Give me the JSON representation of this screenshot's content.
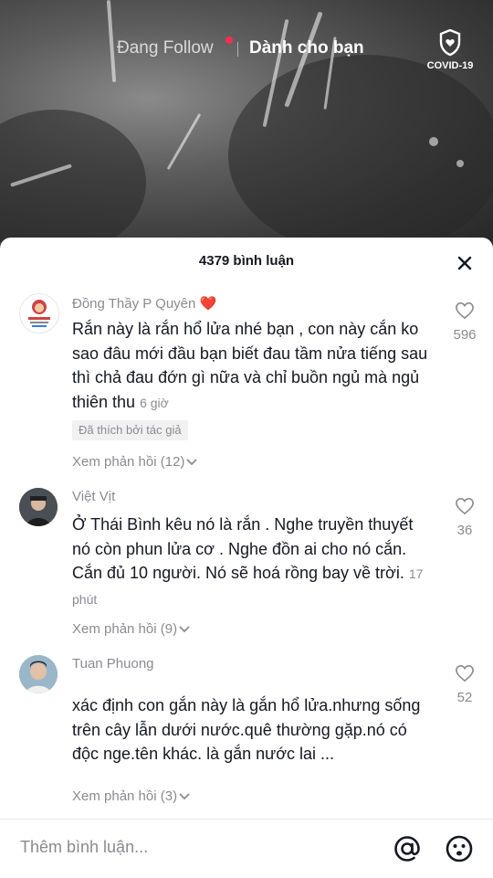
{
  "topnav": {
    "following": "Đang Follow",
    "for_you": "Dành cho bạn",
    "covid_label": "COVID-19"
  },
  "sheet": {
    "title": "4379 bình luận"
  },
  "comments": [
    {
      "user": "Đồng Thầy P Quyên ❤️",
      "text": "Rắn này là rắn hổ lửa nhé bạn , con này cắn ko sao đâu mới đầu bạn biết đau tầm nửa tiếng sau thì chả đau đớn gì nữa và chỉ buồn ngủ mà ngủ thiên thu",
      "time": "6 giờ",
      "likes": "596",
      "badge": "Đã thích bởi tác giả",
      "replies": "Xem phản hồi (12)"
    },
    {
      "user": "Việt Vịt",
      "text": "Ở Thái Bình kêu nó là rắn . Nghe truyền thuyết nó còn phun lửa cơ . Nghe đồn ai cho nó cắn. Cắn đủ 10 người. Nó sẽ hoá rồng bay về trời.",
      "time": "17 phút",
      "likes": "36",
      "replies": "Xem phản hồi (9)"
    },
    {
      "user": "Tuan Phuong",
      "text": "xác định con gắn này là gắn hổ lửa.nhưng sống trên cây lẫn dưới nước.quê thường gặp.nó có độc nge.tên khác. là gắn nước lai ...",
      "likes": "52",
      "replies": "Xem phản hồi (3)"
    }
  ],
  "input": {
    "placeholder": "Thêm bình luận..."
  },
  "colors": {
    "accent": "#fe2c55",
    "muted_text": "#8a8b91",
    "text": "#161823"
  }
}
